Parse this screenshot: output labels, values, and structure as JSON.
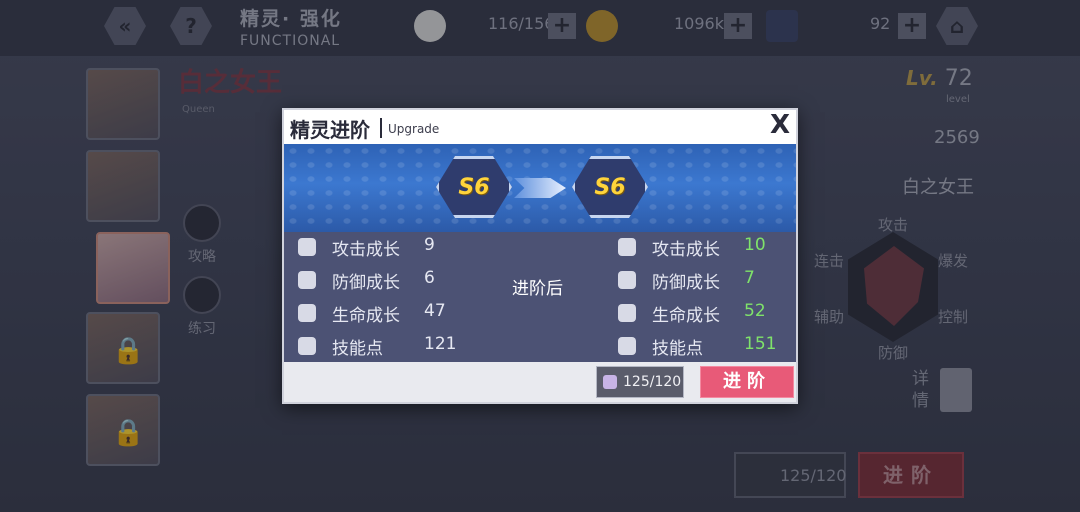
{
  "header": {
    "title_cn": "精灵· 强化",
    "title_en": "FUNCTIONAL",
    "stamina": "116/156",
    "coins": "1096k",
    "gems": "92"
  },
  "background": {
    "spirit_name": "白之女王",
    "spirit_name_en": "Queen",
    "level_prefix": "Lv.",
    "level": "72",
    "level_label": "level",
    "power": "2569",
    "spirit_name_repeat": "白之女王",
    "side_links": [
      "攻略",
      "练习"
    ],
    "radar_labels": {
      "top": "攻击",
      "left_top": "连击",
      "right_top": "爆发",
      "left_bottom": "辅助",
      "right_bottom": "控制",
      "bottom": "防御"
    },
    "detail_label": "详情",
    "cost": "125/120",
    "upgrade_label": "进阶"
  },
  "modal": {
    "title": "精灵进阶",
    "subtitle": "Upgrade",
    "close_label": "X",
    "grade_from": "S6",
    "grade_to": "S6",
    "after_label": "进阶后",
    "before_stats": [
      {
        "label": "攻击成长",
        "value": "9",
        "icon": "sword-icon"
      },
      {
        "label": "防御成长",
        "value": "6",
        "icon": "shield-icon"
      },
      {
        "label": "生命成长",
        "value": "47",
        "icon": "heart-icon"
      },
      {
        "label": "技能点",
        "value": "121",
        "icon": "feather-icon"
      }
    ],
    "after_stats": [
      {
        "label": "攻击成长",
        "value": "10",
        "icon": "sword-icon"
      },
      {
        "label": "防御成长",
        "value": "7",
        "icon": "shield-icon"
      },
      {
        "label": "生命成长",
        "value": "52",
        "icon": "heart-icon"
      },
      {
        "label": "技能点",
        "value": "151",
        "icon": "feather-icon"
      }
    ],
    "cost": "125/120",
    "upgrade_label": "进阶"
  },
  "colors": {
    "accent_green": "#7fe36a",
    "upgrade_pink": "#e85a78",
    "banner_blue": "#3c78d0"
  }
}
